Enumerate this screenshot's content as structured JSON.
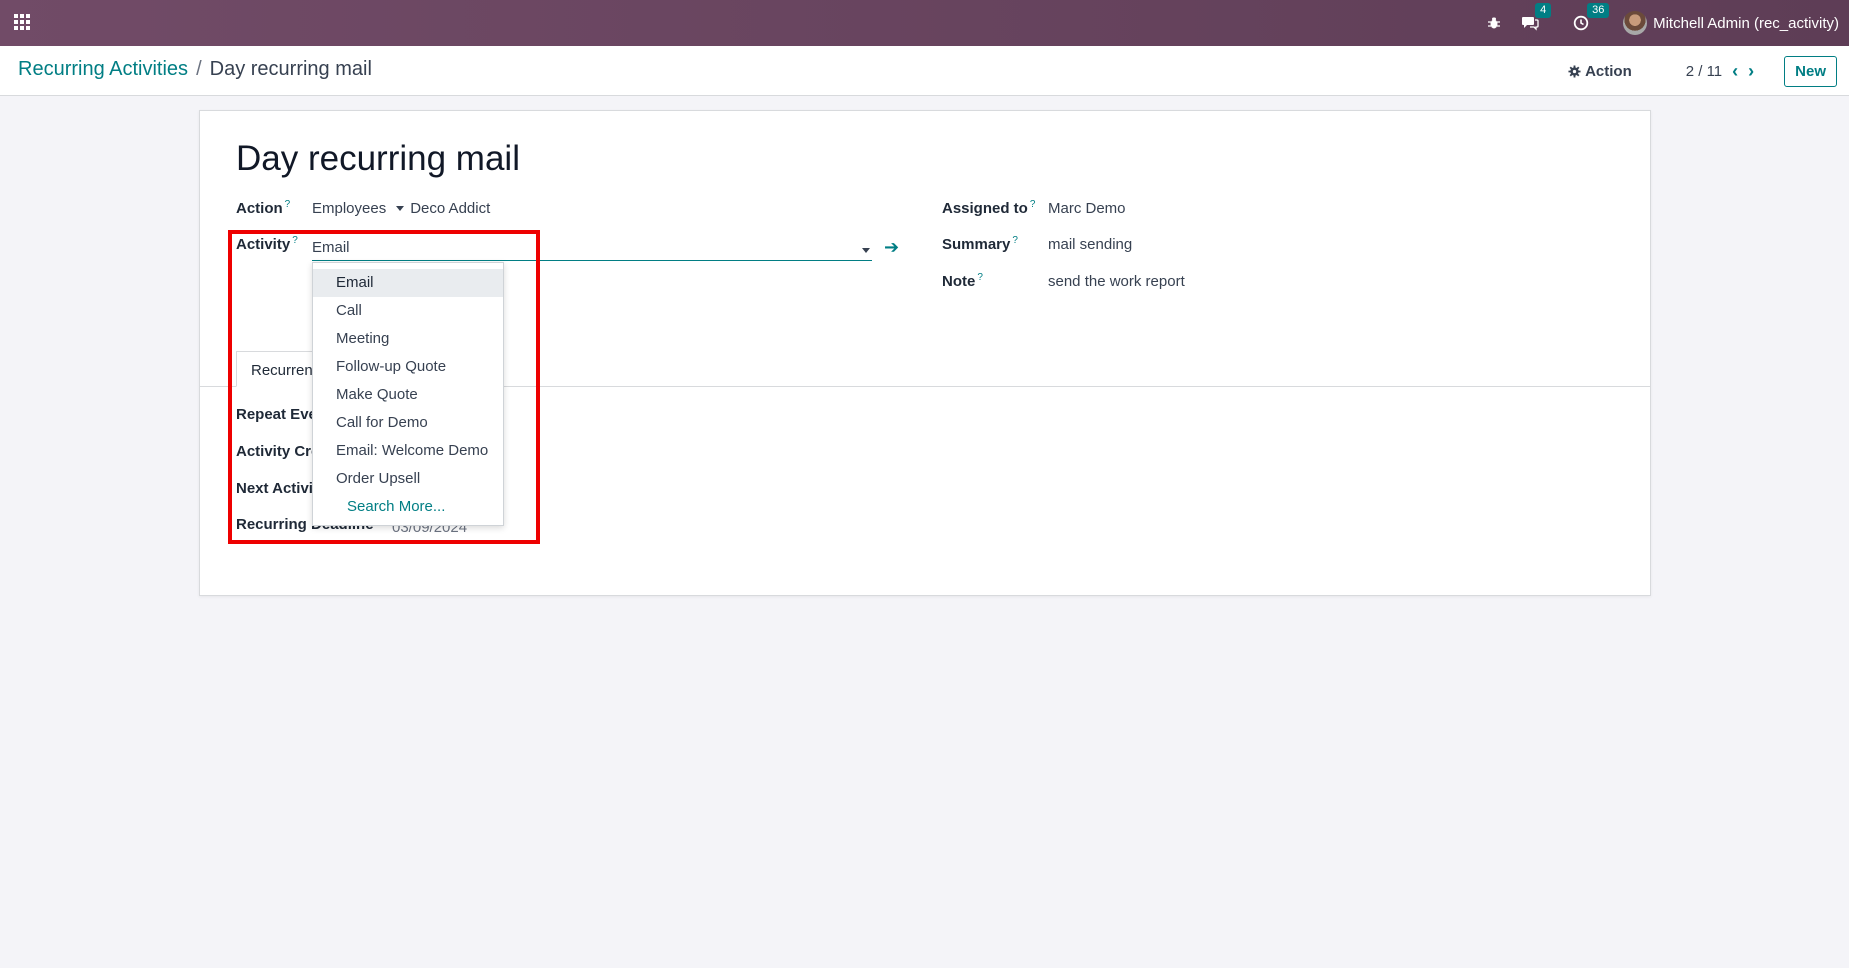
{
  "navbar": {
    "messages_count": "4",
    "activities_count": "36",
    "user_name": "Mitchell Admin (rec_activity)"
  },
  "breadcrumb": {
    "parent": "Recurring Activities",
    "separator": "/",
    "current": "Day recurring mail"
  },
  "control_panel": {
    "action_label": "Action",
    "pager": "2 / 11",
    "new_label": "New"
  },
  "form": {
    "title": "Day recurring mail",
    "action_label": "Action",
    "action_model": "Employees",
    "action_record": "Deco Addict",
    "activity_label": "Activity",
    "activity_value": "Email",
    "assigned_label": "Assigned to",
    "assigned_value": "Marc Demo",
    "summary_label": "Summary",
    "summary_value": "mail sending",
    "note_label": "Note",
    "note_value": "send the work report",
    "tab_label": "Recurrent",
    "repeat_label": "Repeat Ever",
    "activity_created_label": "Activity Crea",
    "next_activity_label": "Next Activity",
    "recurring_deadline_label": "Recurring Deadline",
    "recurring_deadline_value": "03/09/2024"
  },
  "dropdown": {
    "items": [
      "Email",
      "Call",
      "Meeting",
      "Follow-up Quote",
      "Make Quote",
      "Call for Demo",
      "Email: Welcome Demo",
      "Order Upsell"
    ],
    "search_more": "Search More..."
  },
  "colors": {
    "navbar": "#714b67",
    "accent": "#017e84",
    "highlight": "#ee0000"
  }
}
